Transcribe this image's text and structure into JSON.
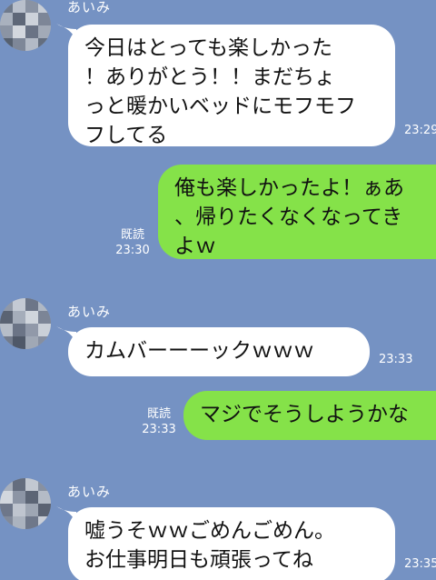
{
  "chat": {
    "messages": [
      {
        "sender": "あいみ",
        "text": "今日はとっても楽しかった\n！ありがとう！！まだちょ\nっと暖かいベッドにモフモフ\nフしてる",
        "time": "23:29"
      },
      {
        "text": "俺も楽しかったよ！ぁあ\n、帰りたくなくなってき\nよｗ",
        "read_label": "既読",
        "time": "23:30"
      },
      {
        "sender": "あいみ",
        "text": "カムバーーーックｗｗｗ",
        "time": "23:33"
      },
      {
        "text": "マジでそうしようかな",
        "read_label": "既読",
        "time": "23:33"
      },
      {
        "sender": "あいみ",
        "text": "嘘うそｗｗごめんごめん。\nお仕事明日も頑張ってね",
        "time": "23:35"
      }
    ]
  },
  "colors": {
    "background": "#7592c3",
    "incoming_bubble": "#ffffff",
    "outgoing_bubble": "#85e249"
  }
}
